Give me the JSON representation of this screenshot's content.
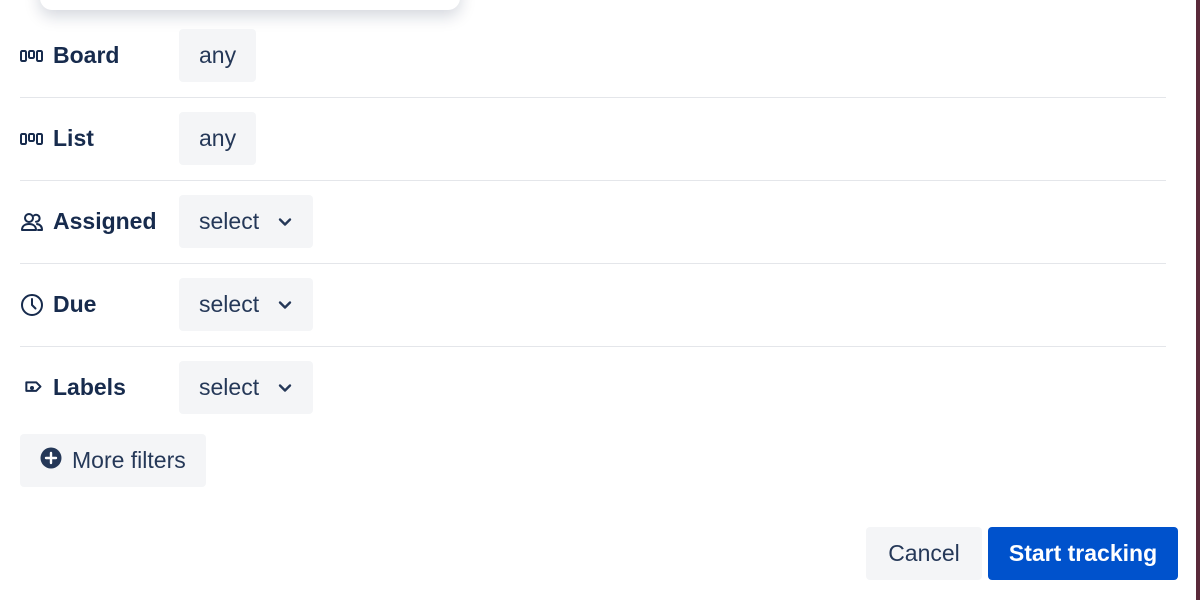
{
  "filters": [
    {
      "label": "Board",
      "icon": "board-icon",
      "value": "any",
      "has_dropdown": false
    },
    {
      "label": "List",
      "icon": "list-icon",
      "value": "any",
      "has_dropdown": false
    },
    {
      "label": "Assigned",
      "icon": "people-icon",
      "value": "select",
      "has_dropdown": true
    },
    {
      "label": "Due",
      "icon": "clock-icon",
      "value": "select",
      "has_dropdown": true
    },
    {
      "label": "Labels",
      "icon": "tag-icon",
      "value": "select",
      "has_dropdown": true
    }
  ],
  "more_filters": {
    "label": "More filters",
    "icon": "plus-circle-icon"
  },
  "actions": {
    "cancel_label": "Cancel",
    "start_label": "Start tracking"
  },
  "colors": {
    "primary": "#0052cc",
    "chip_bg": "#f4f5f7",
    "text": "#172b4d",
    "divider": "#e4e6ea"
  }
}
